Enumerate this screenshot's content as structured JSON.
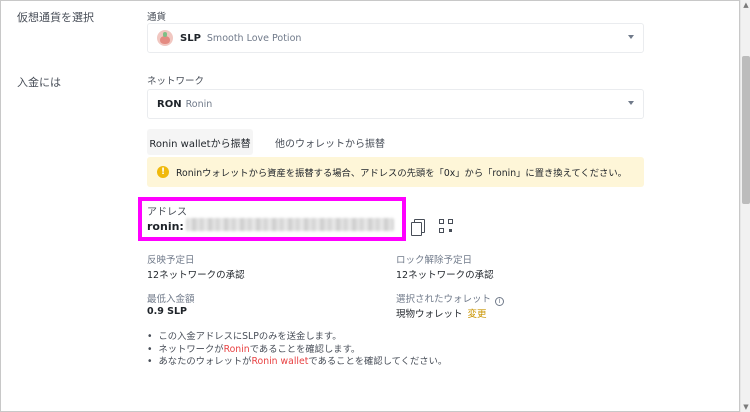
{
  "sections": {
    "select_crypto_label": "仮想通貨を選択",
    "deposit_label": "入金には"
  },
  "currency": {
    "label": "通貨",
    "symbol": "SLP",
    "name": "Smooth Love Potion",
    "icon": "slp-coin-icon"
  },
  "network": {
    "label": "ネットワーク",
    "symbol": "RON",
    "name": "Ronin"
  },
  "tabs": [
    {
      "label": "Ronin walletから振替",
      "active": true
    },
    {
      "label": "他のウォレットから振替",
      "active": false
    }
  ],
  "alert": {
    "text": "Roninウォレットから資産を振替する場合、アドレスの先頭を「0x」から「ronin」に置き換えてください。",
    "icon": "warning-icon"
  },
  "address": {
    "label": "アドレス",
    "prefix": "ronin:"
  },
  "info": {
    "expected_arrival_label": "反映予定日",
    "expected_arrival_value": "12ネットワークの承認",
    "expected_unlock_label": "ロック解除予定日",
    "expected_unlock_value": "12ネットワークの承認",
    "min_deposit_label": "最低入金額",
    "min_deposit_value": "0.9 SLP",
    "selected_wallet_label": "選択されたウォレット",
    "selected_wallet_value": "現物ウォレット",
    "change_link": "変更"
  },
  "notes": [
    {
      "before": "この入金アドレスにSLPのみを送金します。",
      "highlight": "",
      "after": ""
    },
    {
      "before": "ネットワークが",
      "highlight": "Ronin",
      "after": "であることを確認します。"
    },
    {
      "before": "あなたのウォレットが",
      "highlight": "Ronin wallet",
      "after": "であることを確認してください。"
    }
  ],
  "colors": {
    "accent": "#f0b90b",
    "alert_bg": "#fef6d8",
    "highlight_border": "#ff00ff",
    "link": "#c99400",
    "emphasis": "#e84142"
  }
}
